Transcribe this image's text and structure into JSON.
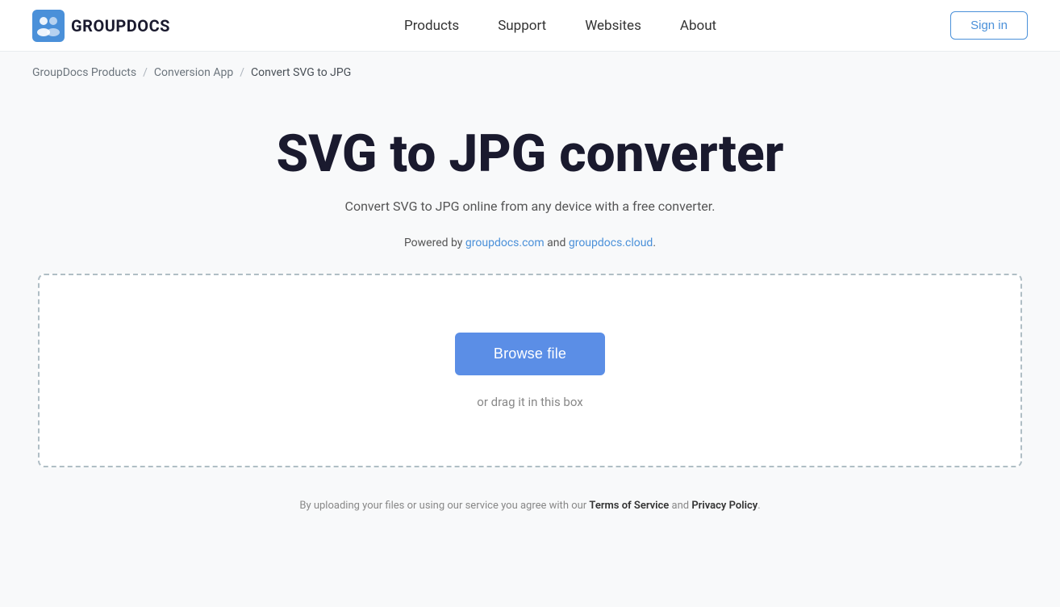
{
  "brand": {
    "logo_text": "GROUPDOCS",
    "logo_alt": "GroupDocs logo"
  },
  "navbar": {
    "links": [
      {
        "label": "Products",
        "id": "products"
      },
      {
        "label": "Support",
        "id": "support"
      },
      {
        "label": "Websites",
        "id": "websites"
      },
      {
        "label": "About",
        "id": "about"
      }
    ],
    "sign_in_label": "Sign in"
  },
  "breadcrumb": {
    "items": [
      {
        "label": "GroupDocs Products",
        "id": "groupdocs-products"
      },
      {
        "label": "Conversion App",
        "id": "conversion-app"
      },
      {
        "label": "Convert SVG to JPG",
        "id": "convert-svg-jpg"
      }
    ]
  },
  "hero": {
    "title": "SVG to JPG converter",
    "subtitle": "Convert SVG to JPG online from any device with a free converter.",
    "powered_by_prefix": "Powered by ",
    "powered_by_link1_text": "groupdocs.com",
    "powered_by_link1_url": "#",
    "powered_by_between": " and ",
    "powered_by_link2_text": "groupdocs.cloud",
    "powered_by_link2_url": "#",
    "powered_by_suffix": "."
  },
  "upload": {
    "browse_button_label": "Browse file",
    "drag_text": "or drag it in this box"
  },
  "footer": {
    "note_prefix": "By uploading your files or using our service you agree with our ",
    "tos_label": "Terms of Service",
    "note_between": " and ",
    "privacy_label": "Privacy Policy",
    "note_suffix": "."
  },
  "colors": {
    "accent": "#5b8ee6",
    "link": "#4a90d9",
    "text_dark": "#1a1a2e",
    "text_muted": "#888"
  }
}
